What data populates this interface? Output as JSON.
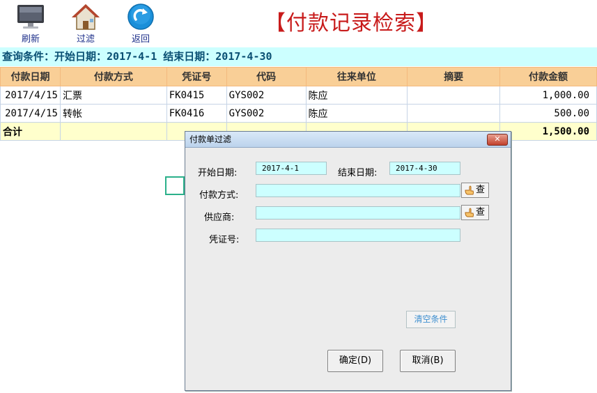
{
  "toolbar": {
    "refresh_label": "刷新",
    "filter_label": "过滤",
    "back_label": "返回"
  },
  "page_title": "【付款记录检索】",
  "query": {
    "text": "查询条件：开始日期：2017-4-1 结束日期：2017-4-30"
  },
  "table": {
    "headers": [
      "付款日期",
      "付款方式",
      "凭证号",
      "代码",
      "往来单位",
      "摘要",
      "付款金额"
    ],
    "rows": [
      [
        "2017/4/15",
        "汇票",
        "FK0415",
        "GYS002",
        "陈应",
        "",
        "1,000.00"
      ],
      [
        "2017/4/15",
        "转帐",
        "FK0416",
        "GYS002",
        "陈应",
        "",
        "500.00"
      ]
    ],
    "total_label": "合计",
    "total_amount": "1,500.00"
  },
  "dialog": {
    "title": "付款单过滤",
    "close_label": "✕",
    "start_date_label": "开始日期:",
    "start_date_value": "2017-4-1",
    "end_date_label": "结束日期:",
    "end_date_value": "2017-4-30",
    "payment_method_label": "付款方式:",
    "payment_method_value": "",
    "supplier_label": "供应商:",
    "supplier_value": "",
    "voucher_label": "凭证号:",
    "voucher_value": "",
    "lookup_label": "查",
    "clear_label": "清空条件",
    "ok_label": "确定(D)",
    "cancel_label": "取消(B)"
  },
  "colors": {
    "title_red": "#c81b1b",
    "query_bar": "#ccffff",
    "header_orange": "#f9cf97",
    "total_row": "#ffffcc",
    "input_cyan": "#ccffff"
  },
  "icons": {
    "refresh": "monitor-icon",
    "filter": "house-icon",
    "back": "return-arrow-icon",
    "lookup": "pointing-hand-icon"
  }
}
